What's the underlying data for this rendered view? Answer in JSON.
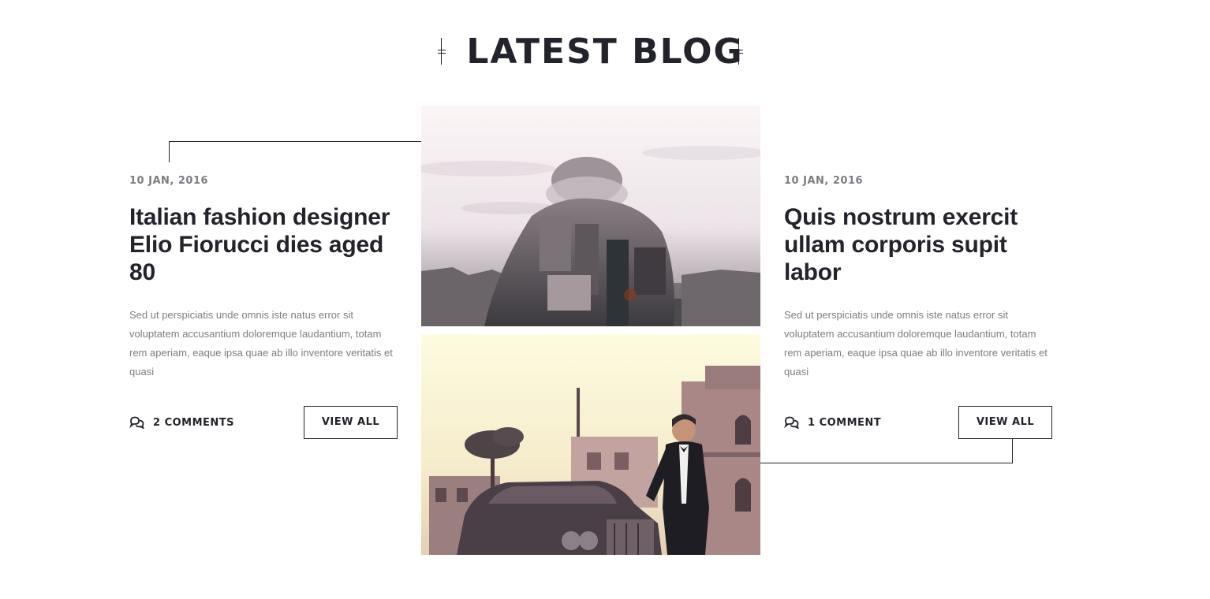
{
  "section": {
    "title": "LATEST BLOG"
  },
  "posts": [
    {
      "date": "10 JAN, 2016",
      "title": "Italian fashion designer Elio Fiorucci dies aged 80",
      "excerpt": "Sed ut perspiciatis unde omnis iste natus error sit voluptatem accusantium doloremque laudantium, totam rem aperiam, eaque ipsa quae ab illo inventore veritatis et quasi",
      "comments": "2 COMMENTS",
      "button": "VIEW ALL"
    },
    {
      "date": "10 JAN, 2016",
      "title": "Quis nostrum exercit ullam corporis supit labor",
      "excerpt": "Sed ut perspiciatis unde omnis iste natus error sit voluptatem accusantium doloremque laudantium, totam rem aperiam, eaque ipsa quae ab illo inventore veritatis et quasi",
      "comments": "1 COMMENT",
      "button": "VIEW ALL"
    }
  ],
  "icons": {
    "comments": "comments-icon",
    "ornament": "title-ornament-icon"
  },
  "colors": {
    "text_dark": "#22232b",
    "text_muted": "#7c7d84",
    "background": "#ffffff"
  }
}
